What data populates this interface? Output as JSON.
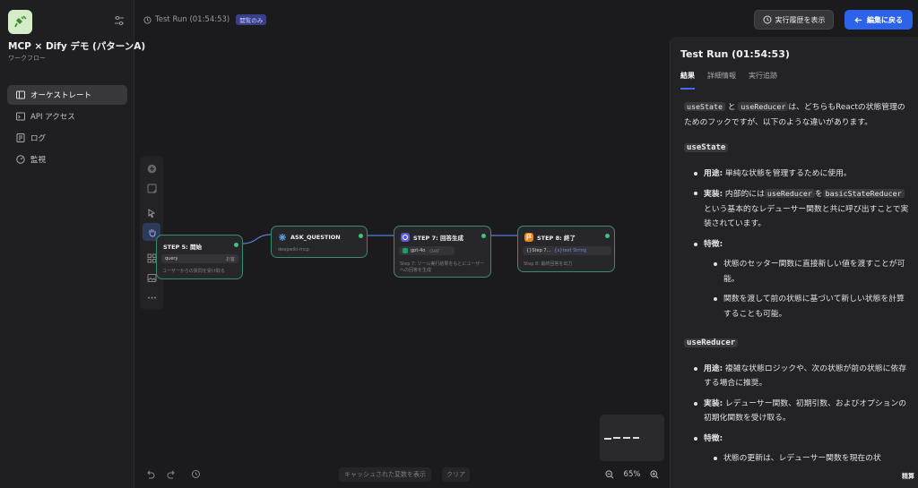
{
  "app": {
    "name": "MCP × Dify デモ (パターンA)",
    "type": "ワークフロー"
  },
  "nav": [
    {
      "label": "オーケストレート",
      "icon": "layout-icon",
      "active": true
    },
    {
      "label": "API アクセス",
      "icon": "terminal-icon",
      "active": false
    },
    {
      "label": "ログ",
      "icon": "log-icon",
      "active": false
    },
    {
      "label": "監視",
      "icon": "monitor-icon",
      "active": false
    }
  ],
  "topbar": {
    "run_label": "Test Run (01:54:53)",
    "badge": "閲覧のみ",
    "history_button": "実行履歴を表示",
    "back_button": "編集に戻る"
  },
  "nodes": {
    "start": {
      "title": "STEP 5: 開始",
      "field": "query",
      "field_badge": "お客",
      "sub": "ユーザーからの質問を受け取る"
    },
    "ask": {
      "title": "ASK_QUESTION",
      "sub": "deepwiki-mcp"
    },
    "llm": {
      "title": "STEP 7: 回答生成",
      "model": "gpt-4o",
      "model_badge": "CHAT",
      "sub1": "Step 7: ツール実行結果をもとにユーザー",
      "sub2": "への回答を生成"
    },
    "end": {
      "title": "STEP 8: 終了",
      "var": "{}Step 7...",
      "var_type": "{x}text String",
      "sub": "Step 8: 最終回答を出力"
    }
  },
  "canvas": {
    "cache_button": "キャッシュされた変数を表示",
    "clear_button": "クリア",
    "zoom": "65%"
  },
  "panel": {
    "title": "Test Run (01:54:53)",
    "tabs": [
      "結果",
      "詳細情報",
      "実行追跡"
    ],
    "intro_code1": "useState",
    "intro_and": "と",
    "intro_code2": "useReducer",
    "intro_text": "は、どちらもReactの状態管理のためのフックですが、以下のような違いがあります。",
    "h1": "useState",
    "s1_b1_label": "用途:",
    "s1_b1_text": " 単純な状態を管理するために使用。",
    "s1_b2_label": "実装:",
    "s1_b2_text1": " 内部的には",
    "s1_b2_code1": "useReducer",
    "s1_b2_text2": "を",
    "s1_b2_code2": "basicStateReducer",
    "s1_b2_text3": "という基本的なレデューサー関数と共に呼び出すことで実装されています。",
    "s1_b3_label": "特徴:",
    "s1_sub1": "状態のセッター関数に直接新しい値を渡すことが可能。",
    "s1_sub2": "関数を渡して前の状態に基づいて新しい状態を計算することも可能。",
    "h2": "useReducer",
    "s2_b1_label": "用途:",
    "s2_b1_text": " 複雑な状態ロジックや、次の状態が前の状態に依存する場合に推奨。",
    "s2_b2_label": "実装:",
    "s2_b2_text": " レデューサー関数、初期引数、およびオプションの初期化関数を受け取る。",
    "s2_b3_label": "特徴:",
    "s2_sub1": "状態の更新は、レデューサー関数を現在の状"
  },
  "corner_label": "精算"
}
